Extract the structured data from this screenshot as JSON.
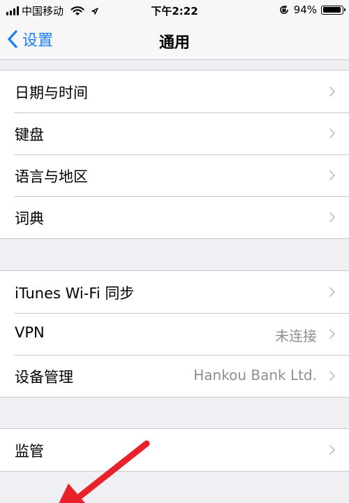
{
  "status_bar": {
    "carrier": "中国移动",
    "time": "下午2:22",
    "battery_percent": "94%",
    "battery_level": 0.94,
    "signal_icon": "signal-bars-icon",
    "wifi_icon": "wifi-icon",
    "location_icon": "location-icon",
    "lock_icon": "rotation-lock-icon"
  },
  "nav": {
    "back_label": "设置",
    "title": "通用"
  },
  "group1": [
    {
      "label": "日期与时间"
    },
    {
      "label": "键盘"
    },
    {
      "label": "语言与地区"
    },
    {
      "label": "词典"
    }
  ],
  "group2": [
    {
      "label": "iTunes Wi-Fi 同步",
      "value": ""
    },
    {
      "label": "VPN",
      "value": "未连接"
    },
    {
      "label": "设备管理",
      "value": "Hankou Bank Ltd."
    }
  ],
  "group3": [
    {
      "label": "监管"
    }
  ],
  "colors": {
    "accent": "#1a7cf4",
    "annotation_arrow": "#e8222a",
    "background": "#efeff4"
  }
}
